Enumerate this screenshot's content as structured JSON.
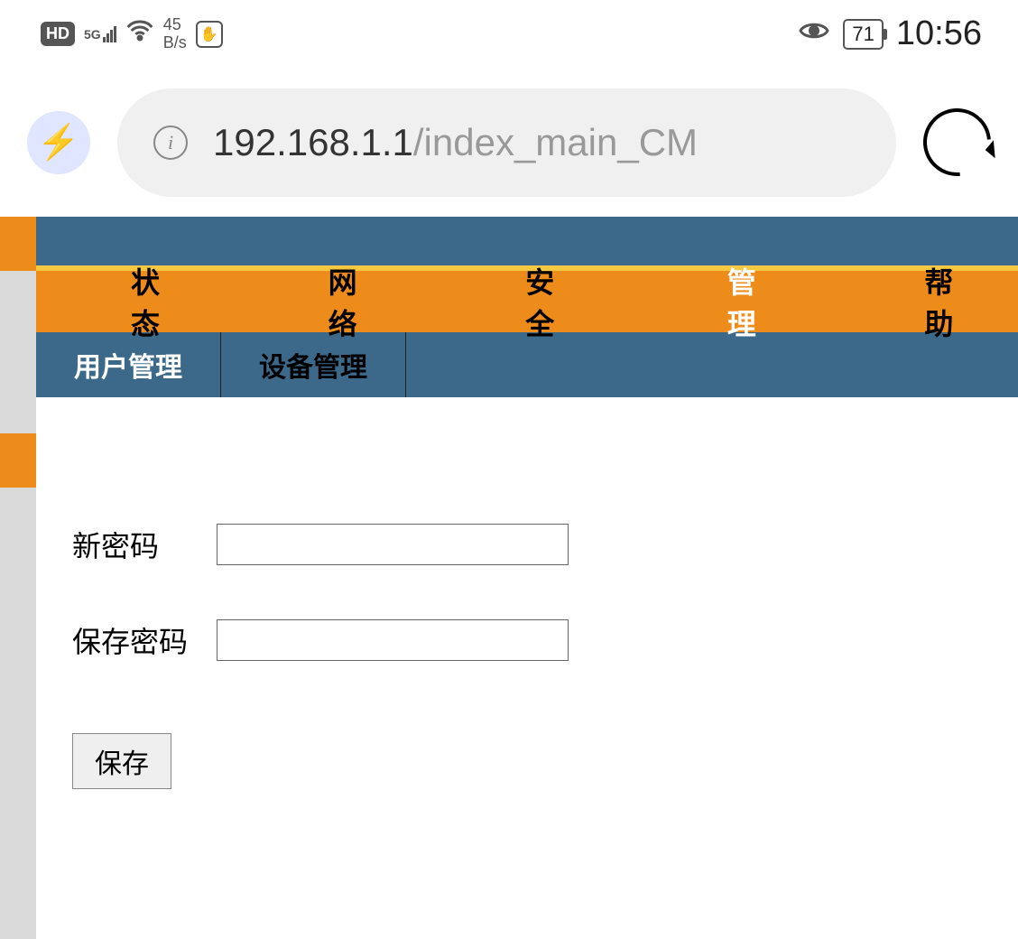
{
  "statusBar": {
    "hd": "HD",
    "network": "5G",
    "rate_value": "45",
    "rate_unit": "B/s",
    "battery": "71",
    "time": "10:56"
  },
  "browser": {
    "url_host": "192.168.1.1",
    "url_path": "/index_main_CM"
  },
  "mainNav": {
    "items": [
      "状态",
      "网络",
      "安全",
      "管理",
      "帮助"
    ],
    "active_index": 3
  },
  "subNav": {
    "items": [
      "用户管理",
      "设备管理"
    ],
    "active_index": 0
  },
  "form": {
    "new_password_label": "新密码",
    "confirm_password_label": "保存密码",
    "save_button": "保存"
  }
}
